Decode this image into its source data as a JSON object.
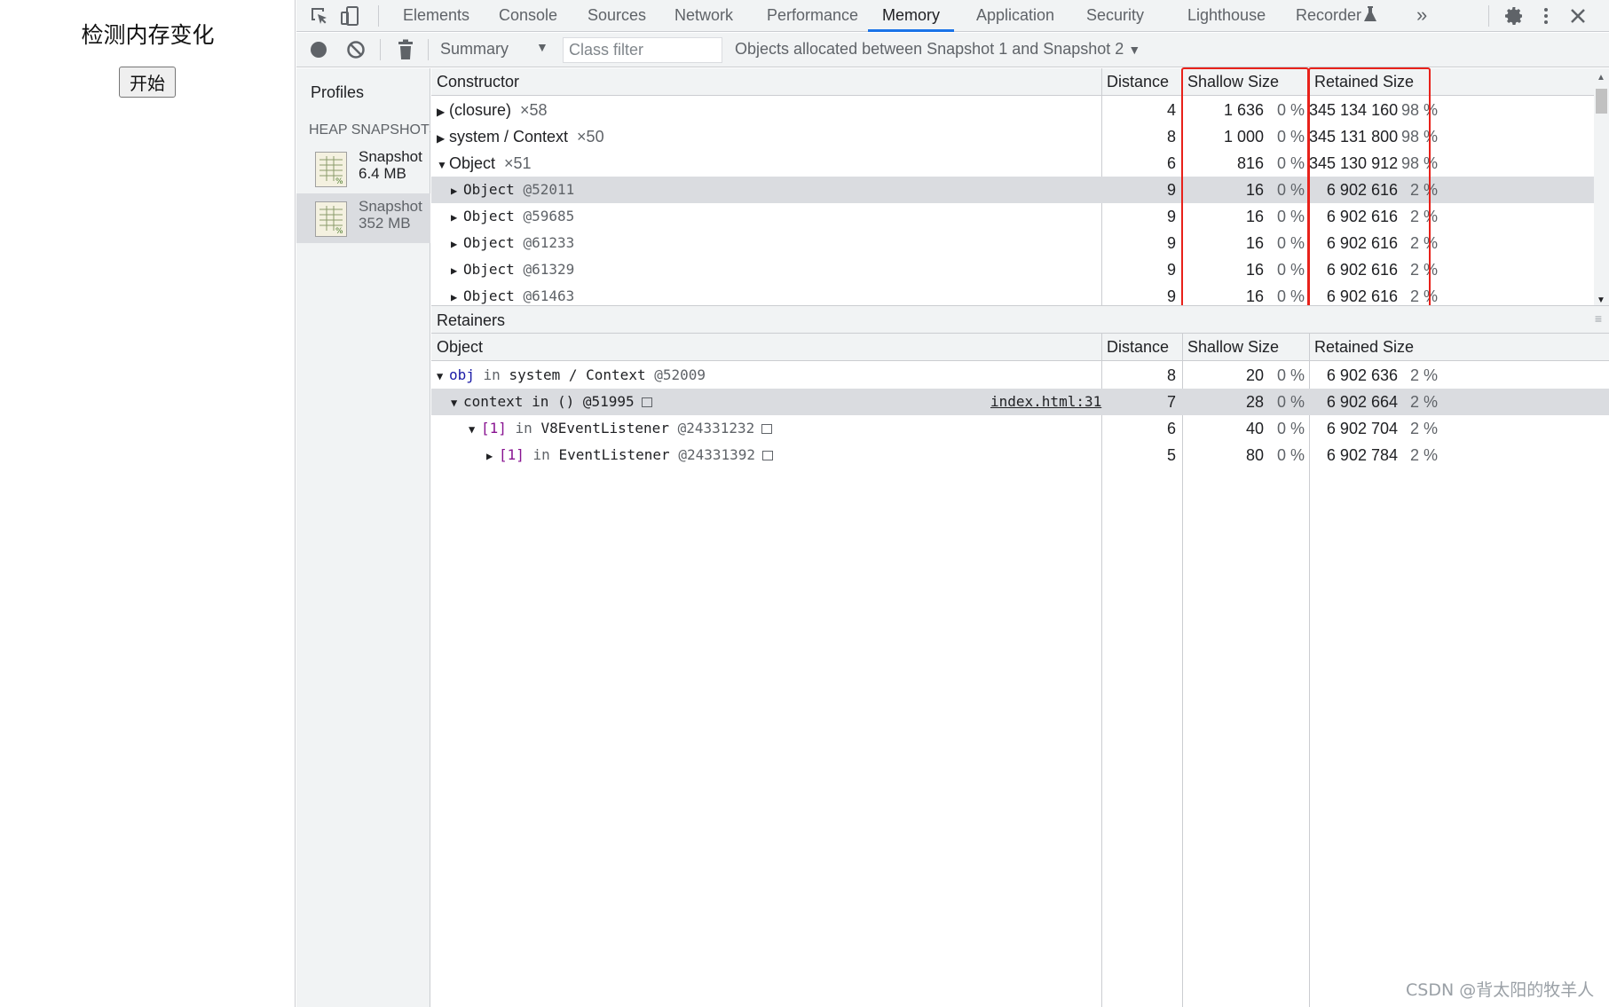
{
  "page": {
    "title": "检测内存变化",
    "start_button": "开始"
  },
  "devtools": {
    "tabs": [
      {
        "label": "Elements"
      },
      {
        "label": "Console"
      },
      {
        "label": "Sources"
      },
      {
        "label": "Network"
      },
      {
        "label": "Performance"
      },
      {
        "label": "Memory"
      },
      {
        "label": "Application"
      },
      {
        "label": "Security"
      },
      {
        "label": "Lighthouse"
      },
      {
        "label": "Recorder"
      }
    ],
    "active_tab": "Memory",
    "overflow_label": "»",
    "toolbar": {
      "view_select": "Summary",
      "class_filter_placeholder": "Class filter",
      "snapshot_range": "Objects allocated between Snapshot 1 and Snapshot 2"
    },
    "profiles": {
      "title": "Profiles",
      "heap_header": "HEAP SNAPSHOTS",
      "snapshots": [
        {
          "name": "Snapshot",
          "size": "6.4 MB"
        },
        {
          "name": "Snapshot",
          "size": "352 MB"
        }
      ]
    },
    "constructor_grid": {
      "headers": {
        "constructor": "Constructor",
        "distance": "Distance",
        "shallow": "Shallow Size",
        "retained": "Retained Size"
      },
      "rows": [
        {
          "name": "(closure)",
          "count": "×58",
          "distance": "4",
          "shallow": "1 636",
          "shallow_pct": "0 %",
          "retained": "345 134 160",
          "retained_pct": "98 %"
        },
        {
          "name": "system / Context",
          "count": "×50",
          "distance": "8",
          "shallow": "1 000",
          "shallow_pct": "0 %",
          "retained": "345 131 800",
          "retained_pct": "98 %"
        },
        {
          "name": "Object",
          "count": "×51",
          "distance": "6",
          "shallow": "816",
          "shallow_pct": "0 %",
          "retained": "345 130 912",
          "retained_pct": "98 %"
        },
        {
          "name": "Object",
          "id": "@52011",
          "distance": "9",
          "shallow": "16",
          "shallow_pct": "0 %",
          "retained": "6 902 616",
          "retained_pct": "2 %"
        },
        {
          "name": "Object",
          "id": "@59685",
          "distance": "9",
          "shallow": "16",
          "shallow_pct": "0 %",
          "retained": "6 902 616",
          "retained_pct": "2 %"
        },
        {
          "name": "Object",
          "id": "@61233",
          "distance": "9",
          "shallow": "16",
          "shallow_pct": "0 %",
          "retained": "6 902 616",
          "retained_pct": "2 %"
        },
        {
          "name": "Object",
          "id": "@61329",
          "distance": "9",
          "shallow": "16",
          "shallow_pct": "0 %",
          "retained": "6 902 616",
          "retained_pct": "2 %"
        },
        {
          "name": "Object",
          "id": "@61463",
          "distance": "9",
          "shallow": "16",
          "shallow_pct": "0 %",
          "retained": "6 902 616",
          "retained_pct": "2 %"
        }
      ]
    },
    "retainers": {
      "title": "Retainers",
      "headers": {
        "object": "Object",
        "distance": "Distance",
        "shallow": "Shallow Size",
        "retained": "Retained Size"
      },
      "rows": [
        {
          "prop": "obj",
          "in": "in",
          "target": "system / Context",
          "id": "@52009",
          "distance": "8",
          "shallow": "20",
          "shallow_pct": "0 %",
          "retained": "6 902 636",
          "retained_pct": "2 %"
        },
        {
          "prop": "context",
          "in": "in",
          "target": "()",
          "id": "@51995",
          "link": "index.html:31",
          "distance": "7",
          "shallow": "28",
          "shallow_pct": "0 %",
          "retained": "6 902 664",
          "retained_pct": "2 %"
        },
        {
          "prop": "[1]",
          "in": "in",
          "target": "V8EventListener",
          "id": "@24331232",
          "distance": "6",
          "shallow": "40",
          "shallow_pct": "0 %",
          "retained": "6 902 704",
          "retained_pct": "2 %"
        },
        {
          "prop": "[1]",
          "in": "in",
          "target": "EventListener",
          "id": "@24331392",
          "distance": "5",
          "shallow": "80",
          "shallow_pct": "0 %",
          "retained": "6 902 784",
          "retained_pct": "2 %"
        }
      ]
    }
  },
  "watermark": "CSDN @背太阳的牧羊人",
  "colors": {
    "highlight": "#e8211a",
    "accent": "#1a73e8"
  }
}
